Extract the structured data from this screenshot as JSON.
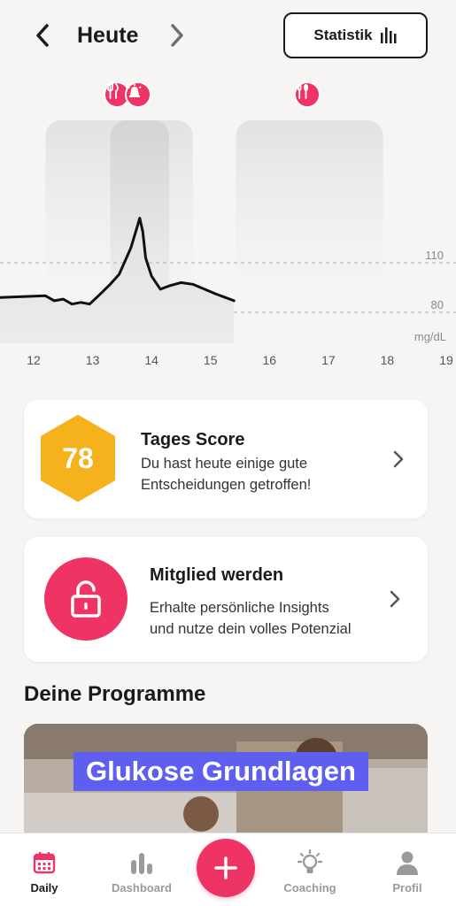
{
  "header": {
    "title": "Heute",
    "statistics_label": "Statistik"
  },
  "chart_data": {
    "type": "line",
    "x_ticks": [
      "12",
      "13",
      "14",
      "15",
      "16",
      "17",
      "18",
      "19"
    ],
    "y_reference_lines": [
      110,
      80
    ],
    "unit": "mg/dL",
    "x": [
      12.0,
      12.2,
      12.35,
      12.5,
      12.65,
      12.8,
      12.95,
      13.1,
      13.3,
      13.45,
      13.55,
      13.65,
      13.75,
      13.8,
      13.85,
      13.9,
      14.0,
      14.15,
      14.3,
      14.5,
      14.7,
      14.9,
      15.1,
      15.25,
      15.4
    ],
    "y": [
      89,
      90,
      87,
      88,
      85,
      86,
      85,
      90,
      97,
      103,
      111,
      119,
      131,
      137,
      129,
      113,
      102,
      94,
      96,
      98,
      97,
      94,
      91,
      89,
      87
    ],
    "meal_markers": [
      {
        "icon": "fork-knife-icon"
      },
      {
        "icon": "alarm-icon"
      },
      {
        "icon": "fork-spoon-icon"
      }
    ]
  },
  "score_card": {
    "score": "78",
    "title": "Tages Score",
    "subtitle_line1": "Du hast heute einige gute",
    "subtitle_line2": "Entscheidungen getroffen!",
    "score_color": "#f6b21d"
  },
  "member_card": {
    "title": "Mitglied werden",
    "subtitle_line1": "Erhalte persönliche Insights",
    "subtitle_line2": "und nutze dein volles Potenzial",
    "accent": "#ee3464"
  },
  "programs": {
    "section_title": "Deine Programme",
    "items": [
      {
        "title": "Glukose Grundlagen"
      }
    ]
  },
  "bottom_nav": {
    "items": [
      {
        "label": "Daily",
        "icon": "calendar-icon",
        "active": true
      },
      {
        "label": "Dashboard",
        "icon": "bar-chart-icon",
        "active": false
      },
      {
        "label": "Coaching",
        "icon": "lightbulb-icon",
        "active": false
      },
      {
        "label": "Profil",
        "icon": "person-icon",
        "active": false
      }
    ]
  }
}
